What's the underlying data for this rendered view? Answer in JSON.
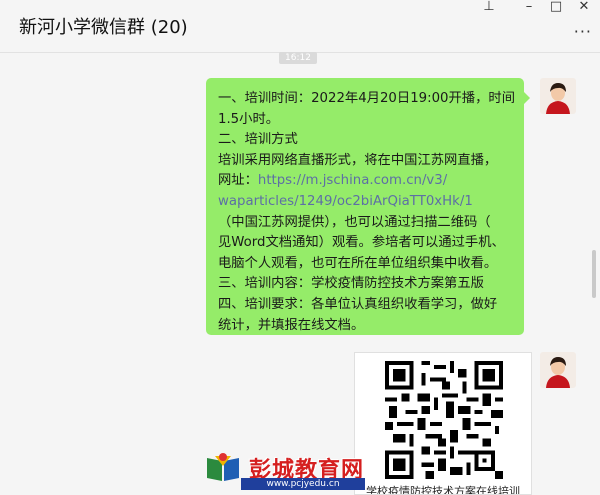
{
  "window": {
    "title": "新河小学微信群 (20)"
  },
  "controls": {
    "pin": "⊥",
    "minimize": "–",
    "maximize": "□",
    "close": "✕",
    "more": "···"
  },
  "chat": {
    "timestamp": "16:12",
    "message_lines": [
      "一、培训时间：2022年4月20日19:00开播，时间",
      "1.5小时。",
      "二、培训方式",
      "培训采用网络直播形式，将在中国江苏网直播，",
      "网址：",
      "https://m.jschina.com.cn/v3/",
      "waparticles/1249/oc2biArQiaTT0xHk/1",
      "（中国江苏网提供），也可以通过扫描二维码（",
      "见Word文档通知）观看。参培者可以通过手机、",
      "电脑个人观看，也可在所在单位组织集中收看。",
      "三、培训内容：学校疫情防控技术方案第五版",
      "四、培训要求：各单位认真组织收看学习，做好",
      "统计，并填报在线文档。"
    ],
    "image_caption": "学校疫情防控技术方案在线培训"
  },
  "watermark": {
    "name": "彭城教育网",
    "url": "www.pcjyedu.cn"
  },
  "colors": {
    "bubble": "#95ec69",
    "link": "#5d6fa5",
    "background": "#f5f5f5"
  }
}
